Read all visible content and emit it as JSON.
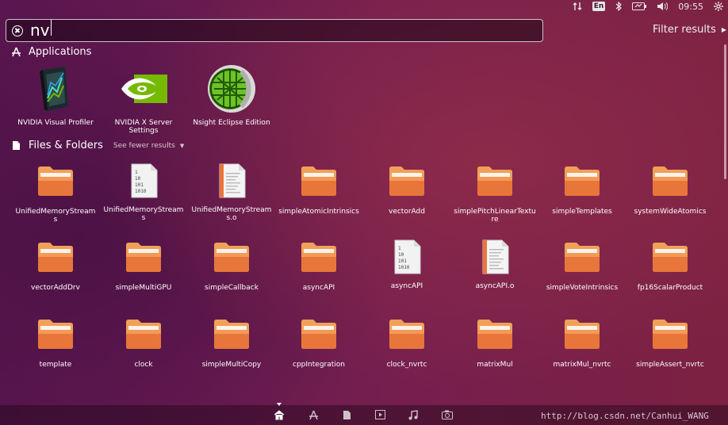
{
  "top_panel": {
    "language": "En",
    "time": "09:55",
    "icons": [
      "network-arrows-icon",
      "bluetooth-icon",
      "battery-icon",
      "volume-icon",
      "gear-icon"
    ]
  },
  "search": {
    "value": "nv",
    "filter_label": "Filter results"
  },
  "applications": {
    "header": "Applications",
    "items": [
      {
        "label": "NVIDIA Visual Profiler",
        "icon": "nvidia-visual-profiler-icon"
      },
      {
        "label": "NVIDIA X Server Settings",
        "icon": "nvidia-settings-icon"
      },
      {
        "label": "Nsight Eclipse Edition",
        "icon": "nsight-icon"
      }
    ]
  },
  "files": {
    "header": "Files & Folders",
    "toggle": "See fewer results",
    "items": [
      {
        "label": "UnifiedMemoryStreams",
        "icon": "folder"
      },
      {
        "label": "UnifiedMemoryStreams",
        "icon": "binary"
      },
      {
        "label": "UnifiedMemoryStreams.o",
        "icon": "text"
      },
      {
        "label": "simpleAtomicIntrinsics",
        "icon": "folder"
      },
      {
        "label": "vectorAdd",
        "icon": "folder"
      },
      {
        "label": "simplePitchLinearTexture",
        "icon": "folder"
      },
      {
        "label": "simpleTemplates",
        "icon": "folder"
      },
      {
        "label": "systemWideAtomics",
        "icon": "folder"
      },
      {
        "label": "vectorAddDrv",
        "icon": "folder"
      },
      {
        "label": "simpleMultiGPU",
        "icon": "folder"
      },
      {
        "label": "simpleCallback",
        "icon": "folder"
      },
      {
        "label": "asyncAPI",
        "icon": "folder"
      },
      {
        "label": "asyncAPI",
        "icon": "binary"
      },
      {
        "label": "asyncAPI.o",
        "icon": "text"
      },
      {
        "label": "simpleVoteIntrinsics",
        "icon": "folder"
      },
      {
        "label": "fp16ScalarProduct",
        "icon": "folder"
      },
      {
        "label": "template",
        "icon": "folder"
      },
      {
        "label": "clock",
        "icon": "folder"
      },
      {
        "label": "simpleMultiCopy",
        "icon": "folder"
      },
      {
        "label": "cppIntegration",
        "icon": "folder"
      },
      {
        "label": "clock_nvrtc",
        "icon": "folder"
      },
      {
        "label": "matrixMul",
        "icon": "folder"
      },
      {
        "label": "matrixMul_nvrtc",
        "icon": "folder"
      },
      {
        "label": "simpleAssert_nvrtc",
        "icon": "folder"
      }
    ]
  },
  "lenses": [
    "home-icon",
    "applications-icon",
    "files-icon",
    "video-icon",
    "music-icon",
    "photo-icon"
  ],
  "watermark": "http://blog.csdn.net/Canhui_WANG",
  "colors": {
    "folder_top": "#f6a05a",
    "folder_body": "#e0682a",
    "accent": "#ffffff"
  }
}
